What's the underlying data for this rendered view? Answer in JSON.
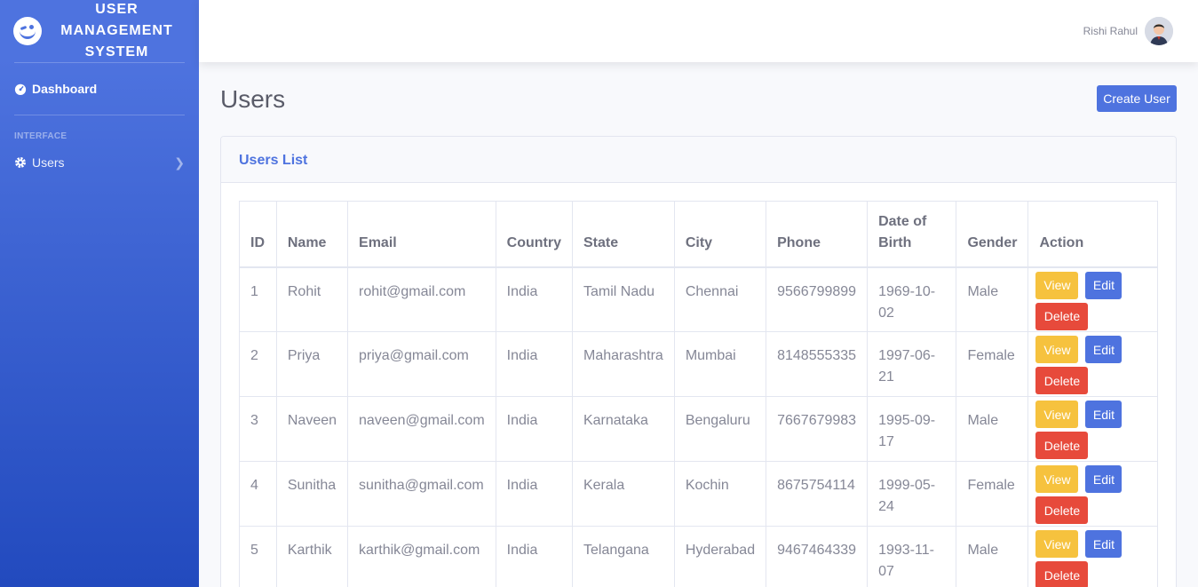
{
  "brand": {
    "title": "USER MANAGEMENT SYSTEM"
  },
  "sidebar": {
    "dashboard": "Dashboard",
    "heading": "INTERFACE",
    "users": "Users"
  },
  "topbar": {
    "user_name": "Rishi Rahul"
  },
  "page": {
    "title": "Users",
    "create_button": "Create User"
  },
  "card": {
    "title": "Users List"
  },
  "table": {
    "headers": [
      "ID",
      "Name",
      "Email",
      "Country",
      "State",
      "City",
      "Phone",
      "Date of Birth",
      "Gender",
      "Action"
    ],
    "rows": [
      {
        "id": "1",
        "name": "Rohit",
        "email": "rohit@gmail.com",
        "country": "India",
        "state": "Tamil Nadu",
        "city": "Chennai",
        "phone": "9566799899",
        "dob": "1969-10-02",
        "gender": "Male"
      },
      {
        "id": "2",
        "name": "Priya",
        "email": "priya@gmail.com",
        "country": "India",
        "state": "Maharashtra",
        "city": "Mumbai",
        "phone": "8148555335",
        "dob": "1997-06-21",
        "gender": "Female"
      },
      {
        "id": "3",
        "name": "Naveen",
        "email": "naveen@gmail.com",
        "country": "India",
        "state": "Karnataka",
        "city": "Bengaluru",
        "phone": "7667679983",
        "dob": "1995-09-17",
        "gender": "Male"
      },
      {
        "id": "4",
        "name": "Sunitha",
        "email": "sunitha@gmail.com",
        "country": "India",
        "state": "Kerala",
        "city": "Kochin",
        "phone": "8675754114",
        "dob": "1999-05-24",
        "gender": "Female"
      },
      {
        "id": "5",
        "name": "Karthik",
        "email": "karthik@gmail.com",
        "country": "India",
        "state": "Telangana",
        "city": "Hyderabad",
        "phone": "9467464339",
        "dob": "1993-11-07",
        "gender": "Male"
      }
    ],
    "actions": {
      "view": "View",
      "edit": "Edit",
      "delete": "Delete"
    }
  },
  "colors": {
    "primary": "#4e73df",
    "warning": "#f6c23e",
    "danger": "#e74a3b"
  }
}
